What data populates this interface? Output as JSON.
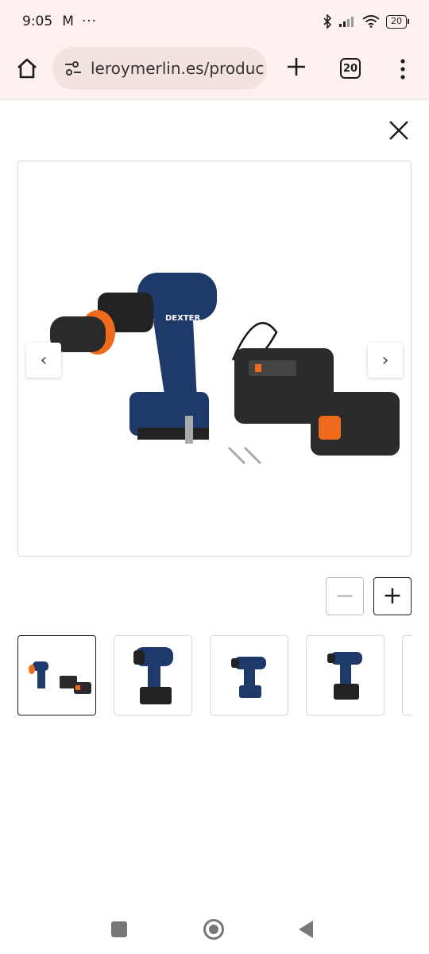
{
  "status": {
    "time": "9:05",
    "mail_icon": "M",
    "dots": "···",
    "battery": "20"
  },
  "browser": {
    "url": "leroymerlin.es/produc",
    "tab_count": "20"
  },
  "gallery": {
    "prev_label": "‹",
    "next_label": "›"
  },
  "zoom": {
    "minus_label": "−",
    "plus_label": "+"
  },
  "thumbnails": [
    {
      "name": "drill-kit-full"
    },
    {
      "name": "impact-wrench"
    },
    {
      "name": "impact-driver"
    },
    {
      "name": "impact-driver-2"
    },
    {
      "name": "partial"
    }
  ],
  "colors": {
    "brand_blue": "#1e3a6b",
    "accent_orange": "#f06a1e",
    "chrome_bg": "#fdf1ef"
  }
}
